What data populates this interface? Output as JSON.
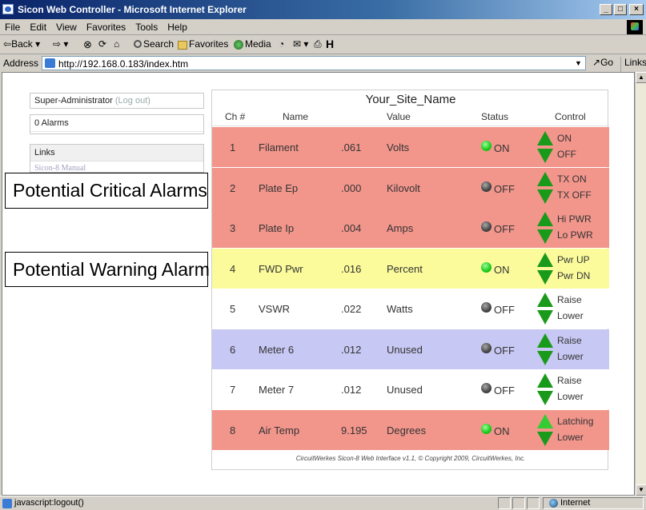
{
  "window": {
    "title": "Sicon Web Controller - Microsoft Internet Explorer"
  },
  "menu": [
    "File",
    "Edit",
    "View",
    "Favorites",
    "Tools",
    "Help"
  ],
  "toolbar": {
    "back": "Back",
    "search": "Search",
    "favorites": "Favorites",
    "media": "Media"
  },
  "address": {
    "label": "Address",
    "url": "http://192.168.0.183/index.htm",
    "go": "Go",
    "links": "Links"
  },
  "left_panel": {
    "user": "Super-Administrator",
    "logout": "(Log out)",
    "alarms": "0 Alarms",
    "links_header": "Links",
    "manual_link": "Sicon-8 Manual"
  },
  "callouts": {
    "critical": "Potential Critical Alarms",
    "warning": "Potential Warning Alarm"
  },
  "site": {
    "name": "Your_Site_Name",
    "headers": {
      "ch": "Ch #",
      "name": "Name",
      "value": "Value",
      "status": "Status",
      "control": "Control"
    },
    "channels": [
      {
        "ch": "1",
        "name": "Filament",
        "value": ".061",
        "unit": "Volts",
        "status": "ON",
        "up": "ON",
        "down": "OFF",
        "bg": "#f2968c"
      },
      {
        "ch": "2",
        "name": "Plate Ep",
        "value": ".000",
        "unit": "Kilovolt",
        "status": "OFF",
        "up": "TX ON",
        "down": "TX OFF",
        "bg": "#f2968c"
      },
      {
        "ch": "3",
        "name": "Plate Ip",
        "value": ".004",
        "unit": "Amps",
        "status": "OFF",
        "up": "Hi PWR",
        "down": "Lo PWR",
        "bg": "#f2968c"
      },
      {
        "ch": "4",
        "name": "FWD Pwr",
        "value": ".016",
        "unit": "Percent",
        "status": "ON",
        "up": "Pwr UP",
        "down": "Pwr DN",
        "bg": "#fbfb9c"
      },
      {
        "ch": "5",
        "name": "VSWR",
        "value": ".022",
        "unit": "Watts",
        "status": "OFF",
        "up": "Raise",
        "down": "Lower",
        "bg": "#ffffff"
      },
      {
        "ch": "6",
        "name": "Meter 6",
        "value": ".012",
        "unit": "Unused",
        "status": "OFF",
        "up": "Raise",
        "down": "Lower",
        "bg": "#c8c8f4"
      },
      {
        "ch": "7",
        "name": "Meter 7",
        "value": ".012",
        "unit": "Unused",
        "status": "OFF",
        "up": "Raise",
        "down": "Lower",
        "bg": "#ffffff"
      },
      {
        "ch": "8",
        "name": "Air Temp",
        "value": "9.195",
        "unit": "Degrees",
        "status": "ON",
        "up": "Latching",
        "down": "Lower",
        "bg": "#f2968c"
      }
    ],
    "footer": "CircuitWerkes Sicon-8 Web Interface v1.1, © Copyright 2009, CircuitWerkes, Inc."
  },
  "status_bar": {
    "text": "javascript:logout()",
    "zone": "Internet"
  }
}
